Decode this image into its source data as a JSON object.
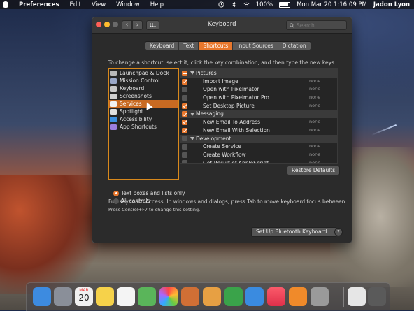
{
  "menubar": {
    "app": "Preferences",
    "menus": [
      "Edit",
      "View",
      "Window",
      "Help"
    ],
    "battery": "100%",
    "clock": "Mon Mar 20  1:16:09 PM",
    "user": "Jadon Lyon"
  },
  "window": {
    "title": "Keyboard",
    "search_placeholder": "Search"
  },
  "tabs": [
    {
      "label": "Keyboard",
      "active": false
    },
    {
      "label": "Text",
      "active": false
    },
    {
      "label": "Shortcuts",
      "active": true
    },
    {
      "label": "Input Sources",
      "active": false
    },
    {
      "label": "Dictation",
      "active": false
    }
  ],
  "instructions": "To change a shortcut, select it, click the key combination, and then type the new keys.",
  "categories": [
    {
      "label": "Launchpad & Dock",
      "icon": "launchpad-icon",
      "selected": false
    },
    {
      "label": "Mission Control",
      "icon": "mission-control-icon",
      "selected": false
    },
    {
      "label": "Keyboard",
      "icon": "keyboard-icon",
      "selected": false
    },
    {
      "label": "Screenshots",
      "icon": "screenshot-icon",
      "selected": false
    },
    {
      "label": "Services",
      "icon": "gear-icon",
      "selected": true
    },
    {
      "label": "Spotlight",
      "icon": "spotlight-icon",
      "selected": false
    },
    {
      "label": "Accessibility",
      "icon": "accessibility-icon",
      "selected": false
    },
    {
      "label": "App Shortcuts",
      "icon": "app-shortcuts-icon",
      "selected": false
    }
  ],
  "shortcuts": [
    {
      "type": "group",
      "label": "Pictures",
      "check": "mixed",
      "key": ""
    },
    {
      "type": "item",
      "label": "Import Image",
      "check": "on",
      "key": "none"
    },
    {
      "type": "item",
      "label": "Open with Pixelmator",
      "check": "off",
      "key": "none"
    },
    {
      "type": "item",
      "label": "Open with Pixelmator Pro",
      "check": "off",
      "key": "none"
    },
    {
      "type": "item",
      "label": "Set Desktop Picture",
      "check": "on",
      "key": "none"
    },
    {
      "type": "group",
      "label": "Messaging",
      "check": "on",
      "key": ""
    },
    {
      "type": "item",
      "label": "New Email To Address",
      "check": "on",
      "key": "none"
    },
    {
      "type": "item",
      "label": "New Email With Selection",
      "check": "on",
      "key": "none"
    },
    {
      "type": "group",
      "label": "Development",
      "check": "off",
      "key": ""
    },
    {
      "type": "item",
      "label": "Create Service",
      "check": "off",
      "key": "none"
    },
    {
      "type": "item",
      "label": "Create Workflow",
      "check": "off",
      "key": "none"
    },
    {
      "type": "item",
      "label": "Get Result of AppleScript",
      "check": "off",
      "key": "none"
    }
  ],
  "buttons": {
    "restore_defaults": "Restore Defaults",
    "bluetooth": "Set Up Bluetooth Keyboard...",
    "help": "?"
  },
  "full_keyboard_access": {
    "text": "Full Keyboard Access: In windows and dialogs, press Tab to move keyboard focus between:",
    "options": [
      {
        "label": "Text boxes and lists only",
        "selected": true
      },
      {
        "label": "All controls",
        "selected": false
      }
    ],
    "hint": "Press Control+F7 to change this setting."
  },
  "dock": {
    "items": [
      "finder-icon",
      "launchpad-icon",
      "calendar-icon",
      "notes-icon",
      "reminders-icon",
      "maps-icon",
      "photos-icon",
      "preview-icon",
      "pages-icon",
      "numbers-icon",
      "keynote-icon",
      "music-icon",
      "books-icon",
      "system-preferences-icon",
      "file-icon",
      "trash-icon"
    ],
    "calendar_month": "MAR",
    "calendar_day": "20"
  }
}
